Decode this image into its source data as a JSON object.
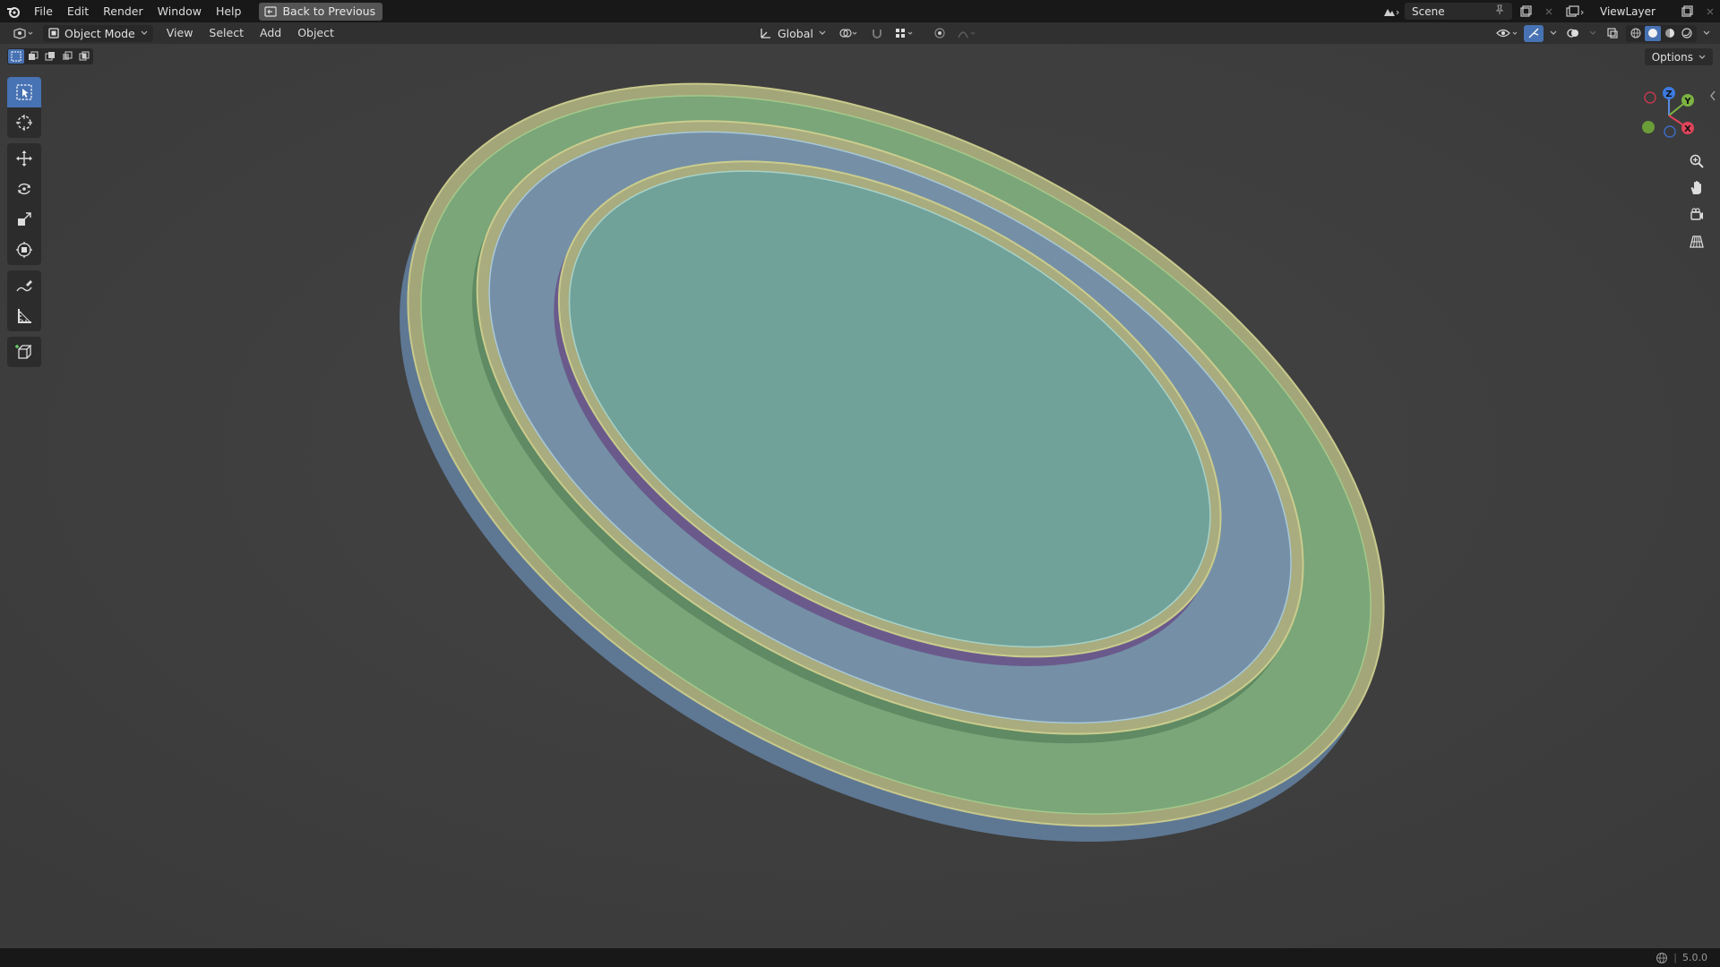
{
  "topbar": {
    "menus": [
      "File",
      "Edit",
      "Render",
      "Window",
      "Help"
    ],
    "back_label": "Back to Previous",
    "scene_name": "Scene",
    "view_layer": "ViewLayer"
  },
  "header": {
    "mode": "Object Mode",
    "menus": [
      "View",
      "Select",
      "Add",
      "Object"
    ],
    "orientation": "Global"
  },
  "viewport": {
    "options_label": "Options"
  },
  "gizmo": {
    "z": "Z",
    "y": "Y",
    "x": "X"
  },
  "status": {
    "version": "5.0.0"
  },
  "colors": {
    "accent": "#4772b3",
    "outer_ring": "#7aa679",
    "middle_ring": "#7590a6",
    "inner_disc": "#70a29a",
    "rim": "#a8ac7e"
  }
}
